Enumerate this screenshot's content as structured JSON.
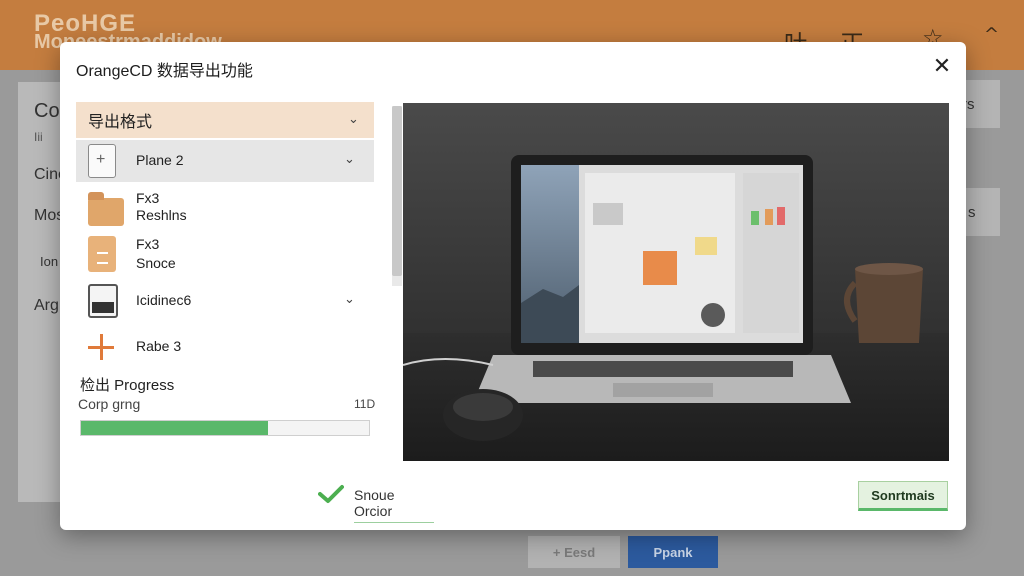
{
  "app": {
    "logo_line1": "PeoHGE",
    "logo_line2": "Moneestrmaddidow",
    "header_icons": [
      "吐",
      "正",
      "☆",
      "^"
    ],
    "sidebar": {
      "title": "Cor",
      "subtitle": "Iii",
      "items": [
        "Cine",
        "Mos",
        "Ion",
        "Arg"
      ]
    },
    "right_labels": [
      "rs",
      "s"
    ],
    "buttons": {
      "secondary": "+ Eesd",
      "primary": "Ppank"
    },
    "colors": {
      "header": "#c47d3f",
      "primary_button": "#2c5a9e"
    }
  },
  "dialog": {
    "title": "OrangeCD  数据导出功能",
    "close_glyph": "✕",
    "format_header": "导出格式",
    "chevron": "⌄",
    "items": [
      {
        "icon": "file-plus-icon",
        "label": "Plane 2",
        "selected": true,
        "has_chevron": true
      },
      {
        "icon": "folder-icon",
        "label_line1": "Fx3",
        "label_line2": "Reshlns"
      },
      {
        "icon": "document-icon",
        "label_line1": "Fx3",
        "label_line2": "Snoce"
      },
      {
        "icon": "monitor-icon",
        "label": "Icidinec6",
        "has_chevron": true
      },
      {
        "icon": "plus-icon",
        "label": "Rabe 3"
      }
    ],
    "progress": {
      "title": "检出 Progress",
      "status": "Corp grng",
      "value_label": "11D",
      "fraction": 0.65
    },
    "footer": {
      "status_label": "Snoue Orcior",
      "action_button": "Sonrtmais"
    },
    "colors": {
      "progress": "#5ab86a",
      "header_band": "#f4e0cc",
      "accent_orange": "#e07a3a"
    }
  }
}
